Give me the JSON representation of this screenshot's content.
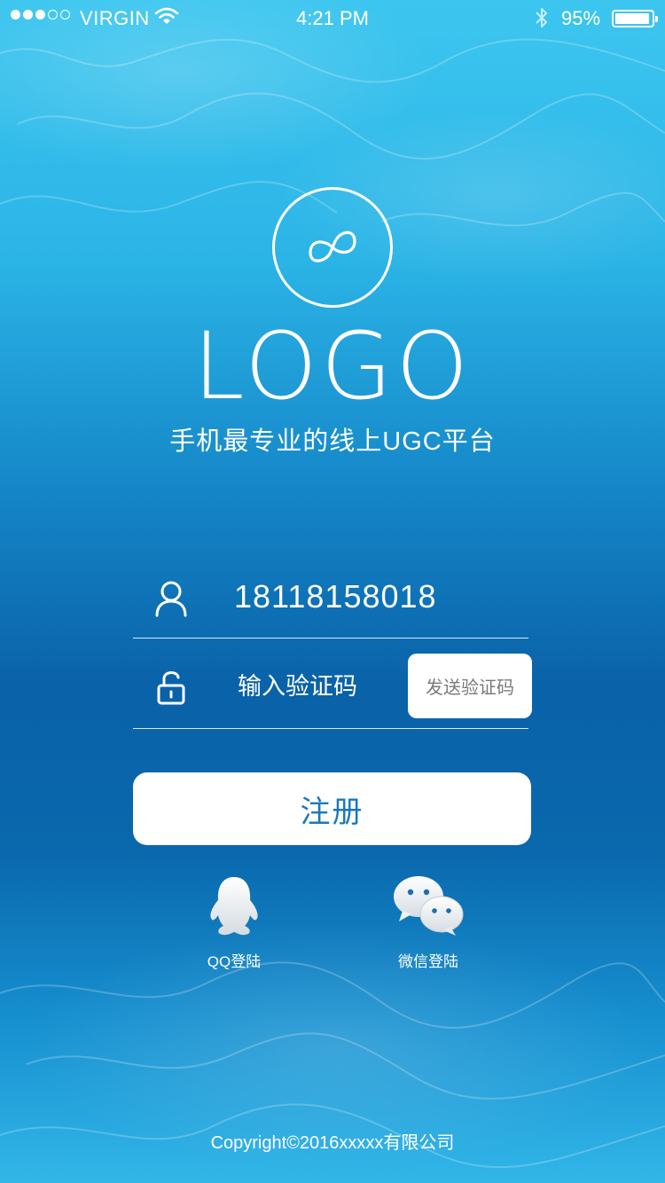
{
  "status_bar": {
    "carrier": "VIRGIN",
    "time": "4:21 PM",
    "battery": "95%",
    "battery_level": 0.95,
    "signal_bars_filled": 3,
    "signal_bars_total": 5
  },
  "brand": {
    "logo_text": "LOGO",
    "slogan": "手机最专业的线上UGC平台"
  },
  "form": {
    "phone_value": "18118158018",
    "code_placeholder": "输入验证码",
    "send_code_label": "发送验证码",
    "register_label": "注册"
  },
  "social": {
    "qq_label": "QQ登陆",
    "wechat_label": "微信登陆"
  },
  "footer": {
    "copyright": "Copyright©2016xxxxx有限公司"
  },
  "icons": {
    "user": "user-icon",
    "lock": "lock-icon",
    "qq": "qq-penguin-icon",
    "wechat": "wechat-icon",
    "logo": "infinity-logo-icon"
  },
  "colors": {
    "accent": "#1a78bd",
    "background_top": "#3cc6ef",
    "background_mid": "#0a62a8"
  }
}
